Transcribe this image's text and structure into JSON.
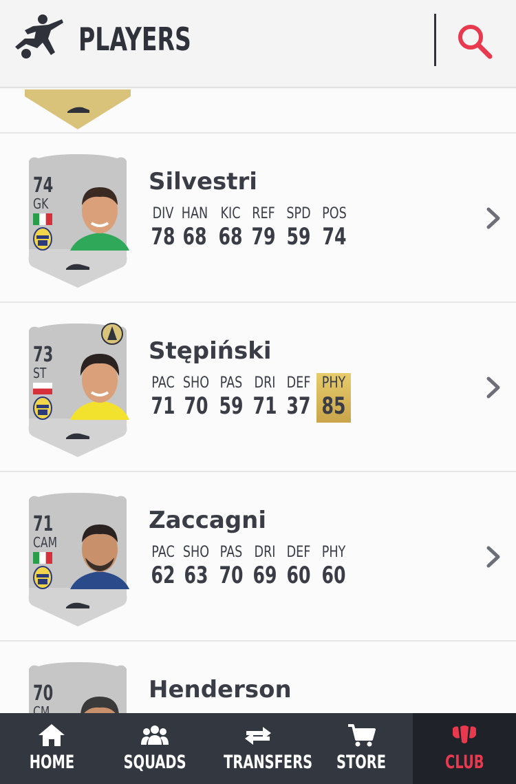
{
  "header": {
    "title": "PLAYERS",
    "logo_icon": "footballer-kick-icon",
    "search_icon": "search-icon",
    "accent": "#e8394f"
  },
  "players": [
    {
      "name": "Silvestri",
      "rating": "74",
      "position": "GK",
      "card_type": "silver",
      "flag": "italy",
      "stats": [
        {
          "label": "DIV",
          "value": "78"
        },
        {
          "label": "HAN",
          "value": "68"
        },
        {
          "label": "KIC",
          "value": "68"
        },
        {
          "label": "REF",
          "value": "79"
        },
        {
          "label": "SPD",
          "value": "59"
        },
        {
          "label": "POS",
          "value": "74"
        }
      ]
    },
    {
      "name": "Stępiński",
      "rating": "73",
      "position": "ST",
      "card_type": "silver",
      "flag": "poland",
      "badge": "chemistry-style-icon",
      "stats": [
        {
          "label": "PAC",
          "value": "71"
        },
        {
          "label": "SHO",
          "value": "70"
        },
        {
          "label": "PAS",
          "value": "59"
        },
        {
          "label": "DRI",
          "value": "71"
        },
        {
          "label": "DEF",
          "value": "37"
        },
        {
          "label": "PHY",
          "value": "85",
          "highlight": true
        }
      ]
    },
    {
      "name": "Zaccagni",
      "rating": "71",
      "position": "CAM",
      "card_type": "silver",
      "flag": "italy",
      "stats": [
        {
          "label": "PAC",
          "value": "62"
        },
        {
          "label": "SHO",
          "value": "63"
        },
        {
          "label": "PAS",
          "value": "70"
        },
        {
          "label": "DRI",
          "value": "69"
        },
        {
          "label": "DEF",
          "value": "60"
        },
        {
          "label": "PHY",
          "value": "60"
        }
      ]
    },
    {
      "name": "Henderson",
      "rating": "70",
      "position": "CM",
      "card_type": "silver",
      "flag": "",
      "stats": []
    }
  ],
  "nav": {
    "items": [
      {
        "label": "HOME",
        "icon": "home-icon"
      },
      {
        "label": "SQUADS",
        "icon": "squads-icon"
      },
      {
        "label": "TRANSFERS",
        "icon": "transfers-icon"
      },
      {
        "label": "STORE",
        "icon": "cart-icon"
      },
      {
        "label": "CLUB",
        "icon": "club-icon",
        "active": true
      }
    ]
  }
}
